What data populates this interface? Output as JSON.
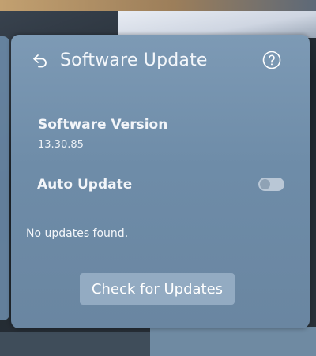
{
  "header": {
    "title": "Software Update",
    "back_icon": "back-arrow-icon",
    "help_icon": "question-mark-icon"
  },
  "software_version": {
    "label": "Software Version",
    "value": "13.30.85"
  },
  "auto_update": {
    "label": "Auto Update",
    "enabled": false
  },
  "status": {
    "message": "No updates found."
  },
  "actions": {
    "check_updates_label": "Check for Updates"
  },
  "colors": {
    "panel": "#7493af",
    "text": "#ffffff",
    "button": "#a9c0d6"
  }
}
